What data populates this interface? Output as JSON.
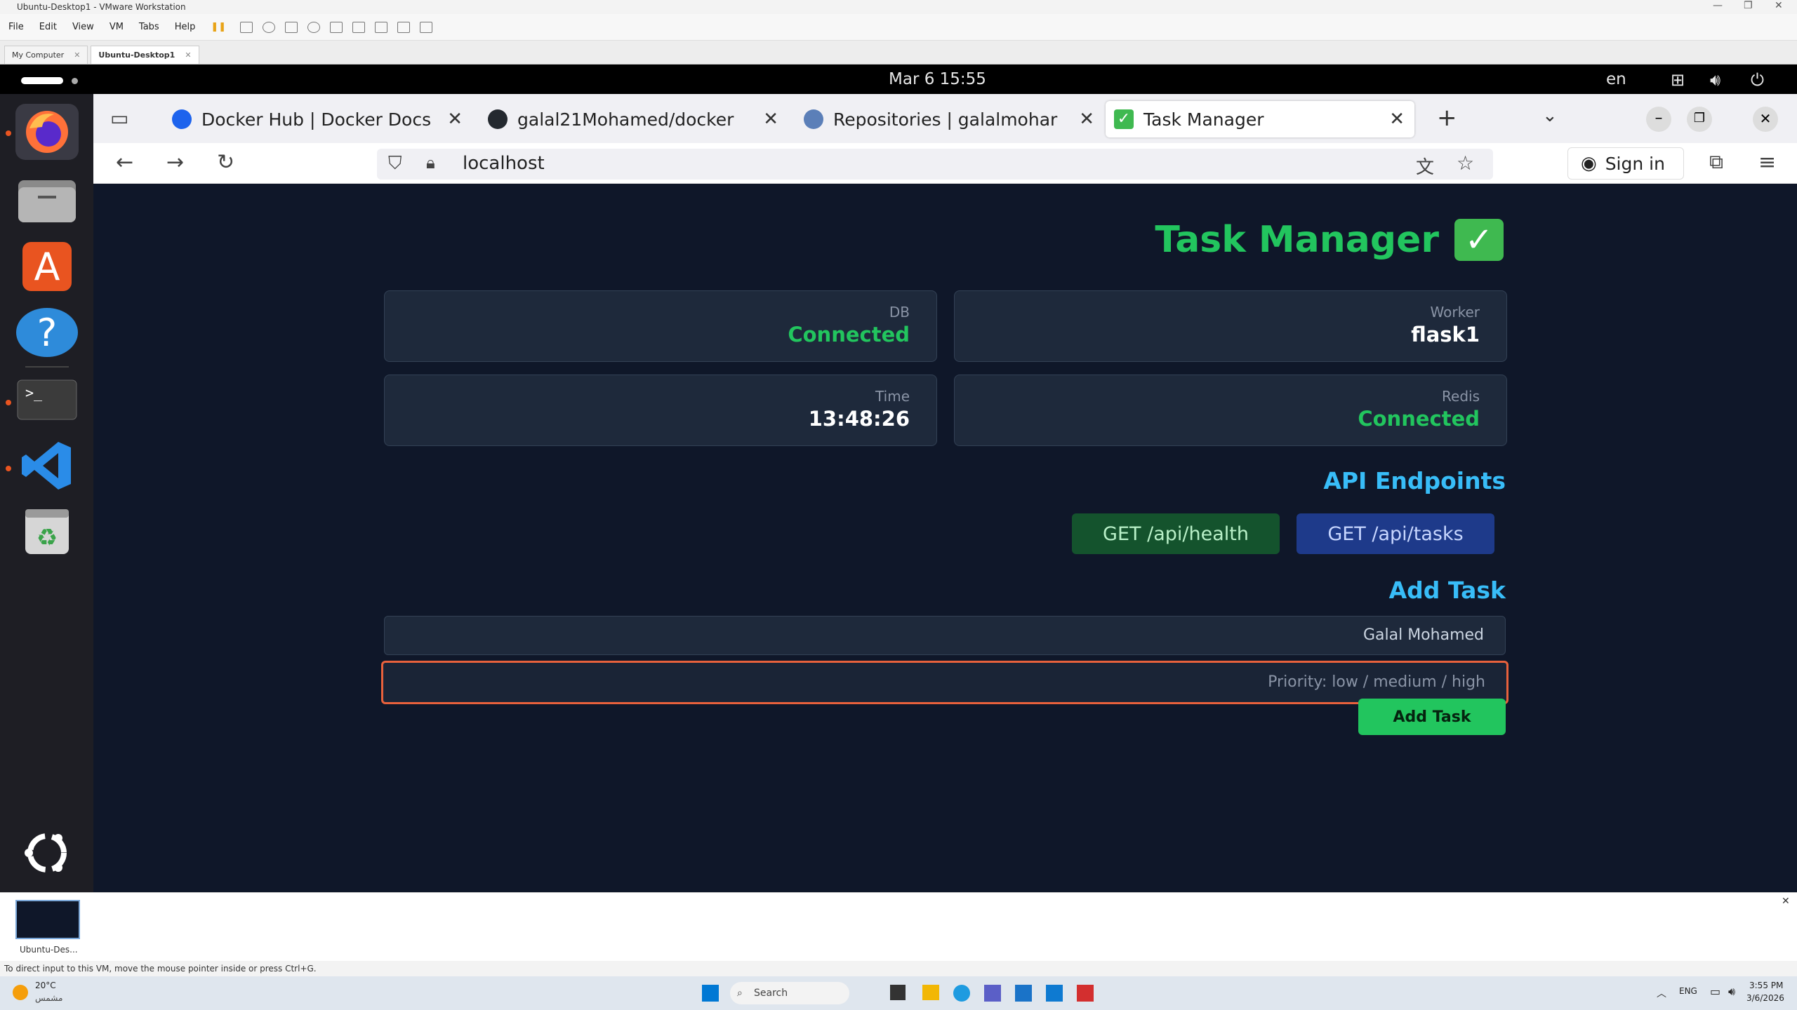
{
  "vmware": {
    "title": "Ubuntu-Desktop1 - VMware Workstation",
    "menu": [
      "File",
      "Edit",
      "View",
      "VM",
      "Tabs",
      "Help"
    ],
    "tabs": [
      "My Computer",
      "Ubuntu-Desktop1"
    ],
    "thumb_label": "Ubuntu-Des...",
    "status_text": "To direct input to this VM, move the mouse pointer inside or press Ctrl+G."
  },
  "ubuntu": {
    "clock": "Mar 6  15:55",
    "lang": "en"
  },
  "browser": {
    "tabs": [
      {
        "label": "Docker Hub | Docker Docs",
        "favicon_color": "#1d63ed"
      },
      {
        "label": "galal21Mohamed/docker",
        "favicon_color": "#24292f"
      },
      {
        "label": "Repositories | galalmohar",
        "favicon_color": "#1d63ed"
      },
      {
        "label": "Task Manager",
        "favicon_color": "#3fb950"
      }
    ],
    "url": "localhost",
    "sign_in": "Sign in"
  },
  "app": {
    "title": "Task Manager",
    "status_cards": [
      {
        "label": "DB",
        "value": "Connected",
        "green": true
      },
      {
        "label": "Worker",
        "value": "flask1",
        "green": false
      },
      {
        "label": "Time",
        "value": "13:48:26",
        "green": false
      },
      {
        "label": "Redis",
        "value": "Connected",
        "green": true
      }
    ],
    "api_title": "API Endpoints",
    "api_health": "GET /api/health",
    "api_tasks": "GET /api/tasks",
    "add_title": "Add Task",
    "name_value": "Galal Mohamed",
    "priority_placeholder": "Priority: low / medium / high",
    "add_button": "Add Task"
  },
  "taskbar": {
    "weather_temp": "20°C",
    "weather_desc": "مشمس",
    "search": "Search",
    "lang": "ENG",
    "time": "3:55 PM",
    "date": "3/6/2026"
  },
  "colors": {
    "accent_green": "#22c55e",
    "accent_blue": "#38bdf8",
    "focus_border": "#e8613c"
  }
}
